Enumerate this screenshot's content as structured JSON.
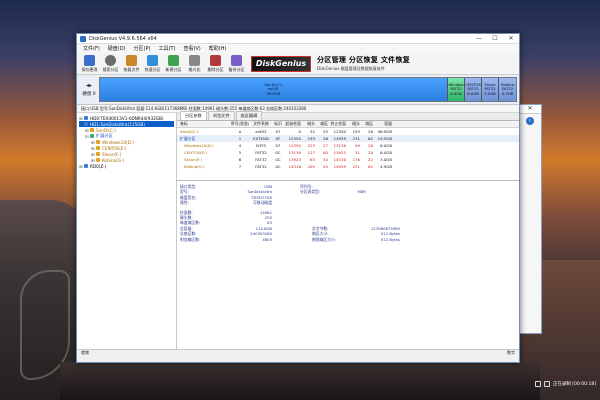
{
  "window": {
    "title": "DiskGenius V4.9.6.564 x64",
    "controls": [
      "—",
      "☐",
      "✕"
    ]
  },
  "menu": [
    "文件(F)",
    "硬盘(D)",
    "分区(P)",
    "工具(T)",
    "查看(V)",
    "帮助(H)"
  ],
  "toolbar": [
    {
      "label": "保存更改",
      "icon": "save-icon",
      "color": "#3d6fc9"
    },
    {
      "label": "搜索分区",
      "icon": "search-icon",
      "color": "#6b6b6b"
    },
    {
      "label": "恢复文件",
      "icon": "recover-icon",
      "color": "#c9872a"
    },
    {
      "label": "快速分区",
      "icon": "quick-partition-icon",
      "color": "#2f8fd9"
    },
    {
      "label": "新建分区",
      "icon": "new-partition-icon",
      "color": "#3fa34d"
    },
    {
      "label": "格式化",
      "icon": "format-icon",
      "color": "#888888"
    },
    {
      "label": "删除分区",
      "icon": "delete-icon",
      "color": "#b33a3a"
    },
    {
      "label": "备份分区",
      "icon": "backup-icon",
      "color": "#7a5cc9"
    }
  ],
  "brand": {
    "logo_text": "DiskGenius",
    "title": "分区管理 分区恢复 文件恢复",
    "subtitle": "DiskGenius 磁盘管理及数据恢复软件"
  },
  "diskmap": {
    "disk_label": "硬盘 0",
    "main_segment": {
      "name": "SanDi(C:)",
      "fs": "exFAT",
      "size": "96.9GB"
    },
    "small_segments": [
      {
        "name": "Window",
        "fs": "FAT32",
        "size": "6.0GB"
      },
      {
        "name": "CENTOS",
        "fs": "FAT32",
        "size": "6.0GB"
      },
      {
        "name": "Slicon",
        "fs": "FAT32",
        "size": "3.0GB"
      },
      {
        "name": "Kebina",
        "fs": "FAT32",
        "size": "4.9GB"
      }
    ]
  },
  "infoline": "接口:USB  型号:SanDiskUltra  容量:114.6GB(117368MB)  柱面数:14961  磁头数:255  每道扇区数:63  总扇区数:240353280",
  "tree": [
    {
      "label": "HD0:TEX40013V1-0DNR44(932GB)",
      "level": 0,
      "type": "disk",
      "selected": false
    },
    {
      "label": "HD1:SanDiskUltra(115GB)",
      "level": 0,
      "type": "disk",
      "selected": true
    },
    {
      "label": "SanDi(C:)",
      "level": 1,
      "type": "part",
      "selected": false
    },
    {
      "label": "扩展分区",
      "level": 1,
      "type": "ext",
      "selected": false
    },
    {
      "label": "Windows10(D:)",
      "level": 2,
      "type": "part",
      "selected": false
    },
    {
      "label": "CENTOS(E:)",
      "level": 2,
      "type": "part",
      "selected": false
    },
    {
      "label": "Slicon(F:)",
      "level": 2,
      "type": "part",
      "selected": false
    },
    {
      "label": "Kebina(G:)",
      "level": 2,
      "type": "part",
      "selected": false
    },
    {
      "label": "RD0(Z:)",
      "level": 0,
      "type": "disk",
      "selected": false
    }
  ],
  "tabs": [
    "分区参数",
    "浏览文件",
    "扇区编辑"
  ],
  "partition_table": {
    "columns": [
      "卷标",
      "序号(状态)",
      "文件系统",
      "标识",
      "起始柱面",
      "磁头",
      "扇区",
      "终止柱面",
      "磁头",
      "扇区",
      "容量"
    ],
    "rows": [
      [
        "SanDi(C:)",
        "0",
        "exFAT",
        "07",
        "0",
        "32",
        "33",
        "12350",
        "193",
        "26",
        "96.9GB"
      ],
      [
        "扩展分区",
        "1",
        "EXTEND",
        "0F",
        "12350",
        "193",
        "26",
        "14959",
        "231",
        "62",
        "19.5GB"
      ],
      [
        "Windows10(D:)",
        "4",
        "NTFS",
        "07",
        "12350",
        "225",
        "27",
        "13136",
        "99",
        "26",
        "6.0GB"
      ],
      [
        "CENTOS(E:)",
        "5",
        "FAT32",
        "0C",
        "13136",
        "127",
        "60",
        "13923",
        "31",
        "28",
        "6.0GB"
      ],
      [
        "Slicon(F:)",
        "6",
        "FAT32",
        "0C",
        "13923",
        "63",
        "30",
        "14316",
        "176",
        "22",
        "3.0GB"
      ],
      [
        "Kebina(G:)",
        "7",
        "FAT32",
        "0C",
        "14316",
        "205",
        "55",
        "14959",
        "231",
        "62",
        "4.9GB"
      ]
    ]
  },
  "details": {
    "block1": [
      {
        "k": "接口类型:",
        "v": "USB",
        "k2": "序列号:",
        "v2": ""
      },
      {
        "k": "型号:",
        "v": "SanDiskUltra",
        "k2": "分区表类型:",
        "v2": "MBR"
      },
      {
        "k": "磁盘签名:",
        "v": "7D5D77D0",
        "k2": "",
        "v2": ""
      },
      {
        "k": "属性:",
        "v": "可移动磁盘",
        "k2": "",
        "v2": ""
      }
    ],
    "block2": [
      {
        "k": "柱面数:",
        "v": "14961",
        "k3": "",
        "v3": ""
      },
      {
        "k": "磁头数:",
        "v": "255",
        "k3": "",
        "v3": ""
      },
      {
        "k": "每道扇区数:",
        "v": "63",
        "k3": "",
        "v3": ""
      },
      {
        "k": "总容量:",
        "v": "114.6GB",
        "k3": "总字节数:",
        "v3": "123060879360"
      },
      {
        "k": "总扇区数:",
        "v": "240353280",
        "k3": "扇区大小:",
        "v3": "512 Bytes"
      },
      {
        "k": "附加扇区数:",
        "v": "4605",
        "k3": "物理扇区大小:",
        "v3": "512 Bytes"
      }
    ]
  },
  "status": {
    "left": "就绪",
    "right": "数字"
  },
  "taskbar": {
    "time_text": "正在录制 [00:00:18]"
  }
}
